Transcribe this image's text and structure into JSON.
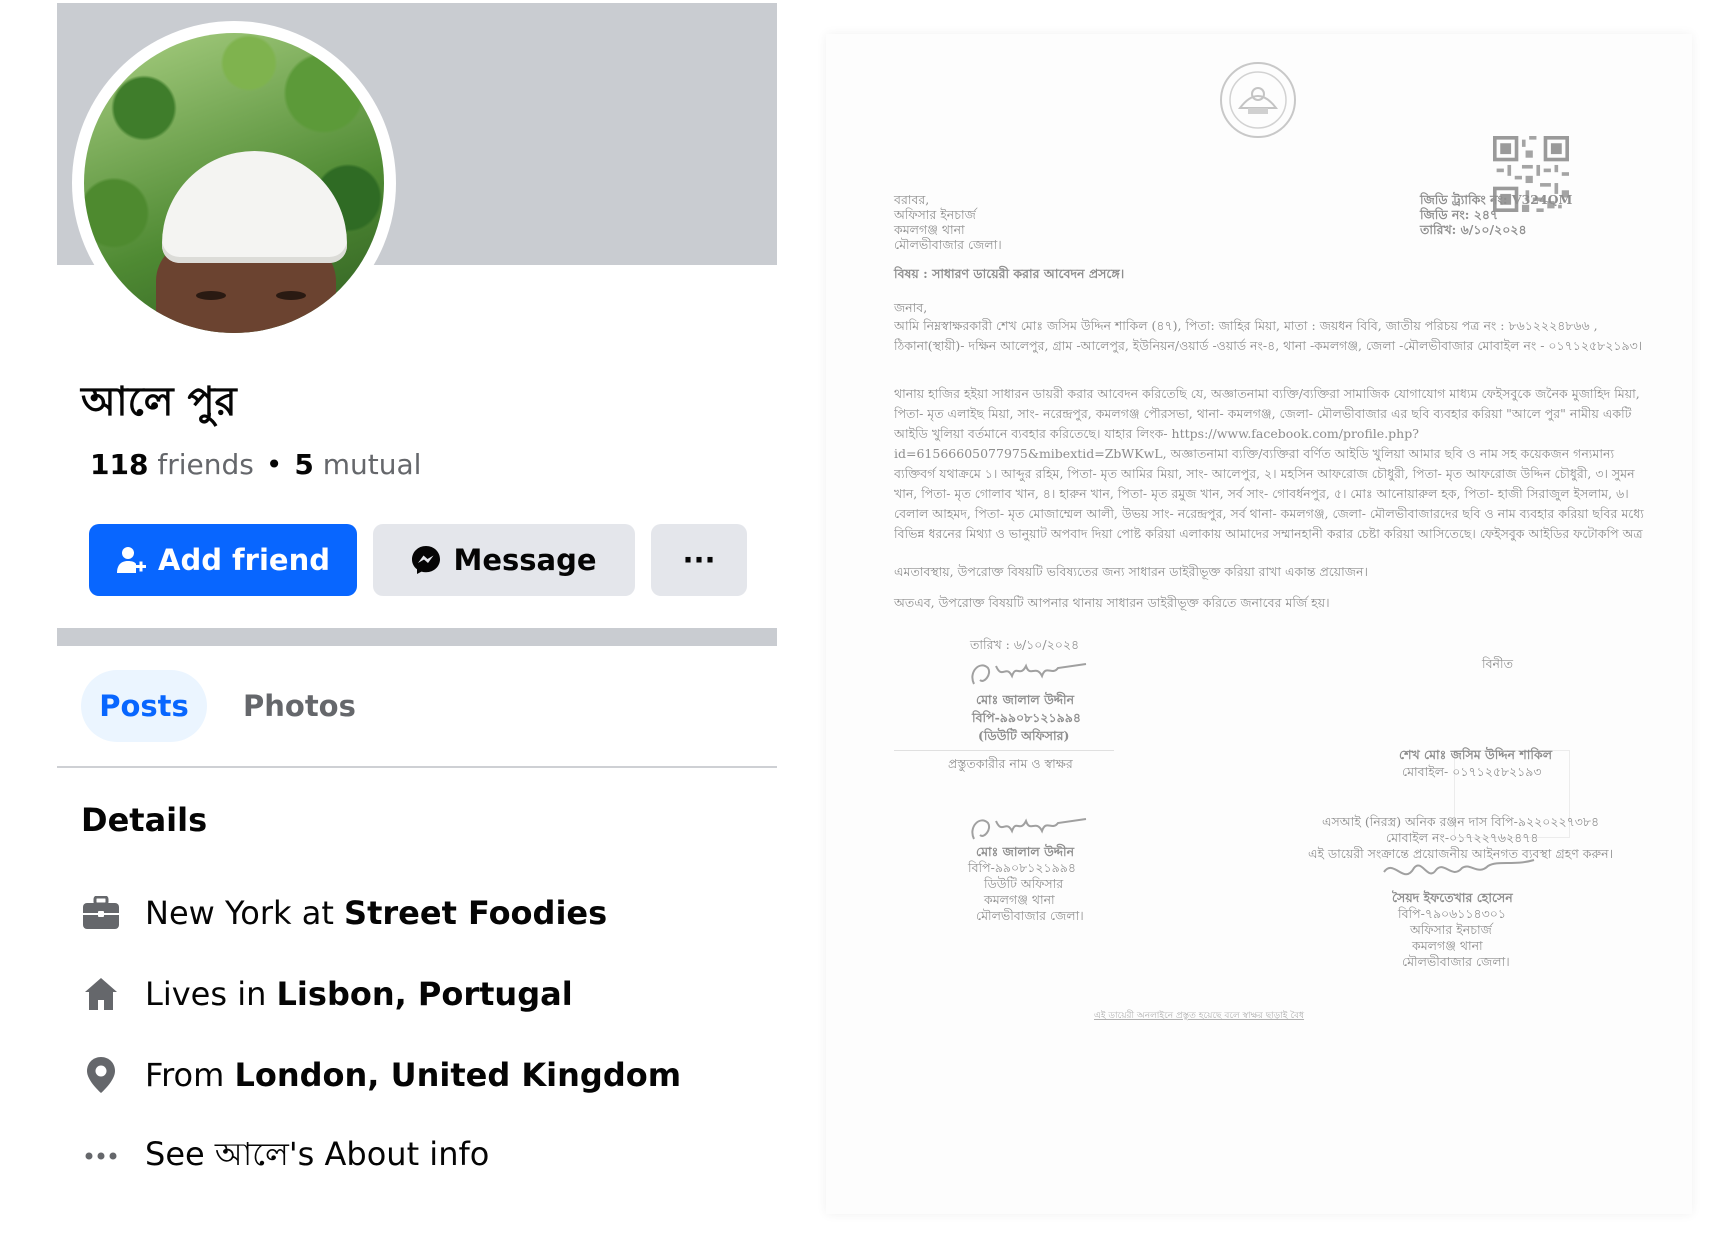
{
  "profile": {
    "name": "আলে পুর",
    "friends_count": "118",
    "friends_word": "friends",
    "separator": "•",
    "mutual_count": "5",
    "mutual_word": "mutual",
    "buttons": {
      "add_friend": "Add friend",
      "message": "Message",
      "more": "···"
    },
    "tabs": [
      {
        "label": "Posts",
        "active": true
      },
      {
        "label": "Photos",
        "active": false
      }
    ],
    "details_title": "Details",
    "details": [
      {
        "icon": "briefcase-icon",
        "prefix": "New York at ",
        "value": "Street Foodies"
      },
      {
        "icon": "home-icon",
        "prefix": "Lives in ",
        "value": "Lisbon, Portugal"
      },
      {
        "icon": "location-pin-icon",
        "prefix": "From ",
        "value": "London, United Kingdom"
      },
      {
        "icon": "more-dots-icon",
        "prefix": "See আলে's About info",
        "value": ""
      }
    ],
    "colors": {
      "accent": "#0866ff",
      "button_grey": "#e4e6eb",
      "cover_grey": "#c9ccd1",
      "tab_active_bg": "#ebf5ff",
      "muted_text": "#65676b"
    }
  },
  "document": {
    "recipient": [
      "বরাবর,",
      "অফিসার ইনচার্জ",
      "কমলগঞ্জ থানা",
      "মৌলভীবাজার জেলা।"
    ],
    "gd_info": [
      "জিডি ট্র্যাকিং নং: V324QM",
      "জিডি নং: ২৪৭",
      "তারিখ: ৬/১০/২০২৪"
    ],
    "subject": "বিষয় : সাধারণ ডায়েরী করার আবেদন প্রসঙ্গে।",
    "salutation": "জনাব,",
    "para1": "আমি নিম্নস্বাক্ষরকারী শেখ মোঃ জসিম উদ্দিন শাকিল (৪৭), পিতা: জাহির মিয়া, মাতা : জয়ধন বিবি, জাতীয় পরিচয় পত্র নং : ৮৬১২২২৪৮৬৬ , ঠিকানা(স্থায়ী)- দক্ষিন আলেপুর, গ্রাম -আলেপুর, ইউনিয়ন/ওয়ার্ড -ওয়ার্ড নং-৪, থানা -কমলগঞ্জ, জেলা -মৌলভীবাজার মোবাইল নং - ০১৭১২৫৮২১৯৩।",
    "para2": "থানায় হাজির হইয়া সাধারন ডায়রী করার আবেদন করিতেছি যে, অজ্ঞাতনামা ব্যক্তি/ব্যক্তিরা সামাজিক যোগাযোগ মাধ্যম ফেইসবুকে জনৈক মুজাহিদ মিয়া, পিতা- মৃত এলাইছ মিয়া, সাং- নরেন্দ্রপুর, কমলগঞ্জ পৌরসভা, থানা- কমলগঞ্জ, জেলা- মৌলভীবাজার এর ছবি ব্যবহার করিয়া \"আলে পুর\" নামীয় একটি আইডি খুলিয়া বর্তমানে ব্যবহার করিতেছে। যাহার লিংক- https://www.facebook.com/profile.php?id=61566605077975&mibextid=ZbWKwL, অজ্ঞাতনামা ব্যক্তি/ব্যক্তিরা বর্ণিত আইডি খুলিয়া আমার ছবি ও নাম সহ কয়েকজন গন্যমান্য ব্যক্তিবর্গ যথাক্রমে ১। আব্দুর রহিম, পিতা- মৃত আমির মিয়া, সাং- আলেপুর, ২। মহসিন আফরোজ চৌধুরী, পিতা- মৃত আফরোজ উদ্দিন চৌধুরী, ৩। সুমন খান, পিতা- মৃত গোলাব খান, ৪। হারুন খান, পিতা- মৃত রমুজ খান, সর্ব সাং- গোবর্ধনপুর, ৫। মোঃ আনোয়ারুল হক, পিতা- হাজী সিরাজুল ইসলাম, ৬। বেলাল আহমদ, পিতা- মৃত মোজাম্মেল আলী, উভয় সাং- নরেন্দ্রপুর, সর্ব থানা- কমলগঞ্জ, জেলা- মৌলভীবাজারদের ছবি ও নাম ব্যবহার করিয়া ছবির মধ্যে বিভিন্ন ধরনের মিথ্যা ও ভানুয়াট অপবাদ দিয়া পোষ্ট করিয়া এলাকায় আমাদের সম্মানহানী করার চেষ্টা করিয়া আসিতেছে। ফেইসবুক আইডির ফটোকপি অত্র সাথে সংযুক্ত। তাই আমার সহ বর্ণিত ব্যক্তিদের মান সম্মান ও ভবিষ্যতের নিরাপত্তার স্বার্থে বিষয়টি আপনার থানায় সাধারন ডায়েরী এন্ট্রি করা একান্ত প্রয়োজন।",
    "para3": "এমতাবস্থায়, উপরোক্ত বিষয়টি ভবিষ্যতের জন্য সাধারন ডাইরীভূক্ত করিয়া রাখা একান্ত প্রয়োজন।",
    "para4": "অতএব, উপরোক্ত বিষয়টি আপনার থানায় সাধারন ডাইরীভূক্ত করিতে জনাবের মর্জি হয়।",
    "date_line": "তারিখ : ৬/১০/২০২৪",
    "yours": "বিনীত",
    "officer_block_1": [
      "মোঃ জালাল উদ্দীন",
      "বিপি-৯৯০৮১২১৯৯৪",
      "(ডিউটি অফিসার)"
    ],
    "preparer_caption": "প্রস্তুতকারীর নাম ও স্বাক্ষর",
    "applicant_block": [
      "শেখ মোঃ জসিম উদ্দিন শাকিল",
      "মোবাইল- ০১৭১২৫৮২১৯৩"
    ],
    "officer_block_2": [
      "মোঃ জালাল উদ্দীন",
      "বিপি-৯৯০৮১২১৯৯৪",
      "ডিউটি অফিসার",
      "কমলগঞ্জ থানা",
      "মৌলভীবাজার জেলা।"
    ],
    "si_block": [
      "এসআই (নিরস্ত্র) অনিক রঞ্জন দাস বিপি-৯২২০২২৭৩৮৪",
      "মোবাইল নং-০১৭২২৭৬২৪৭৪",
      "এই ডায়েরী সংক্রান্তে প্রয়োজনীয় আইনগত ব্যবস্থা গ্রহণ করুন।"
    ],
    "oc_block": [
      "সৈয়দ ইফতেখার হোসেন",
      "বিপি-৭৯০৬১১৪৩০১",
      "অফিসার ইনচার্জ",
      "কমলগঞ্জ থানা",
      "মৌলভীবাজার জেলা।"
    ],
    "footer_note": "এই ডায়েরী অনলাইনে প্রস্তুত হয়েছে বলে স্বাক্ষর ছাড়াই বৈধ"
  }
}
